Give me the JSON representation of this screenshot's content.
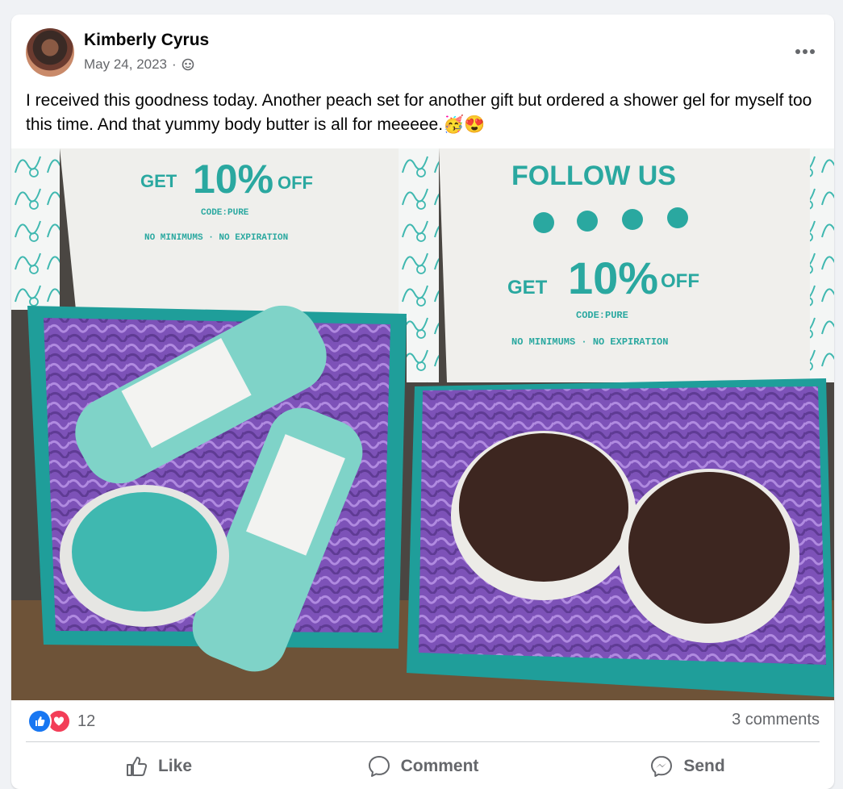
{
  "post": {
    "author": "Kimberly Cyrus",
    "date": "May 24, 2023",
    "separator": "·",
    "caption": "I received this goodness today. Another peach set for another gift but ordered a shower gel for myself too this time.  And that yummy body butter is all for meeeee.🥳😍"
  },
  "photo": {
    "left_box": {
      "get": "GET",
      "discount": "10%",
      "off": "OFF",
      "code": "CODE:PURE",
      "terms": "NO MINIMUMS · NO EXPIRATION",
      "products": [
        "Shower Gel",
        "Body Jelly",
        "Shower Gel"
      ]
    },
    "right_box": {
      "follow": "FOLLOW US",
      "get": "GET",
      "discount": "10%",
      "off": "OFF",
      "code": "CODE:PURE",
      "terms": "NO MINIMUMS · NO EXPIRATION",
      "products": [
        "Body Butter",
        "Body Butter"
      ]
    }
  },
  "footer": {
    "reaction_count": "12",
    "comments": "3 comments",
    "actions": {
      "like": "Like",
      "comment": "Comment",
      "send": "Send"
    }
  },
  "icons": {
    "globe": "globe-icon",
    "more": "more-options-icon",
    "like": "thumbs-up-icon",
    "comment": "speech-bubble-icon",
    "send": "messenger-icon"
  },
  "colors": {
    "teal": "#3fb8b0",
    "purple": "#8b5fc7",
    "like_blue": "#1877f2",
    "love_red": "#f33e58",
    "secondary_text": "#65676b"
  }
}
